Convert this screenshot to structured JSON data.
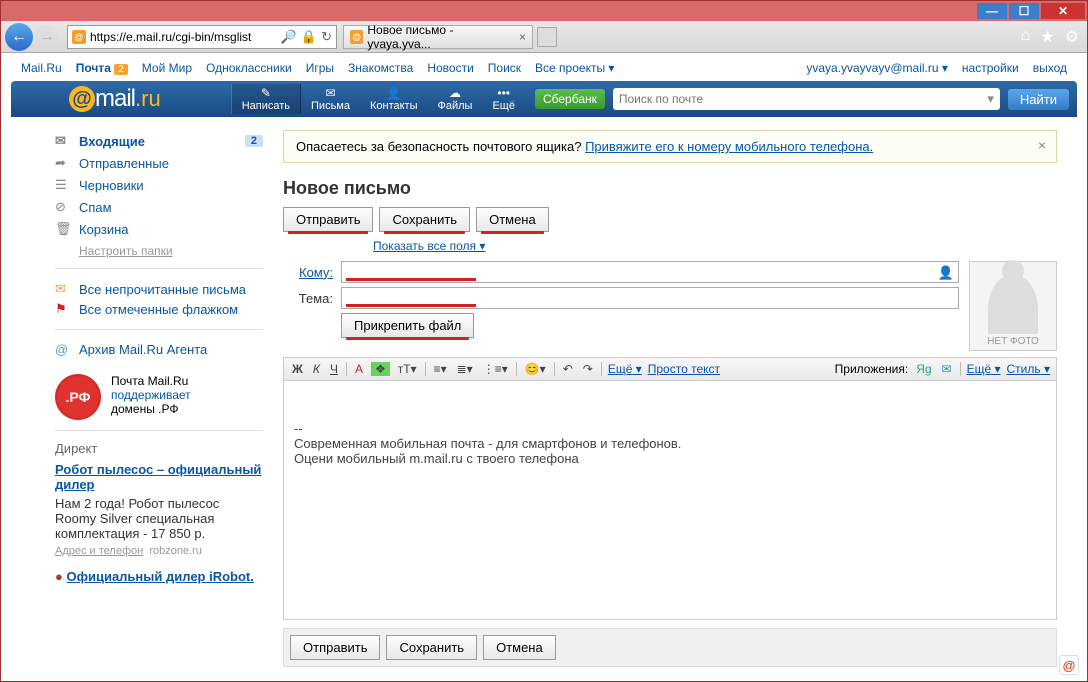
{
  "browser": {
    "url": "https://e.mail.ru/cgi-bin/msglist",
    "tab_title": "Новое письмо - yvaya.yva..."
  },
  "topnav": {
    "items": [
      "Mail.Ru",
      "Почта",
      "Мой Мир",
      "Одноклассники",
      "Игры",
      "Знакомства",
      "Новости",
      "Поиск",
      "Все проекты"
    ],
    "mail_badge": "2",
    "email": "yvaya.yvayvayv@mail.ru",
    "settings": "настройки",
    "logout": "выход"
  },
  "header": {
    "logo_mail": "mail",
    "logo_ru": ".ru",
    "buttons": {
      "compose": "Написать",
      "mails": "Письма",
      "contacts": "Контакты",
      "files": "Файлы",
      "more": "Ещё"
    },
    "sber": "Сбербанк",
    "search_placeholder": "Поиск по почте",
    "find": "Найти"
  },
  "sidebar": {
    "folders": {
      "inbox": "Входящие",
      "inbox_count": "2",
      "sent": "Отправленные",
      "drafts": "Черновики",
      "spam": "Спам",
      "trash": "Корзина"
    },
    "setup_folders": "Настроить папки",
    "unread": "Все непрочитанные письма",
    "flagged": "Все отмеченные флажком",
    "archive": "Архив Mail.Ru Агента",
    "rf": {
      "line1": "Почта Mail.Ru",
      "line2": "поддерживает",
      "line3": "домены .РФ",
      "badge": ".РФ"
    },
    "direkt": {
      "title": "Директ",
      "ad_title": "Робот пылесос – официальный дилер",
      "ad_body": "Нам 2 года! Робот пылесос Roomy Silver специальная комплектация - 17 850 р.",
      "ad_sub": "Адрес и телефон",
      "ad_domain": "robzone.ru",
      "ad2": "Официальный дилер iRobot."
    }
  },
  "alert": {
    "text": "Опасаетесь за безопасность почтового ящика? ",
    "link": "Привяжите его к номеру мобильного телефона."
  },
  "compose": {
    "title": "Новое письмо",
    "send": "Отправить",
    "save": "Сохранить",
    "cancel": "Отмена",
    "show_all": "Показать все поля",
    "to_label": "Кому:",
    "subject_label": "Тема:",
    "attach": "Прикрепить файл",
    "no_photo": "НЕТ ФОТО",
    "body": "--\nСовременная мобильная почта - для смартфонов и телефонов.\nОцени мобильный m.mail.ru с твоего телефона"
  },
  "editor_toolbar": {
    "more": "Ещё",
    "plain": "Просто текст",
    "apps": "Приложения:",
    "style": "Стиль"
  }
}
